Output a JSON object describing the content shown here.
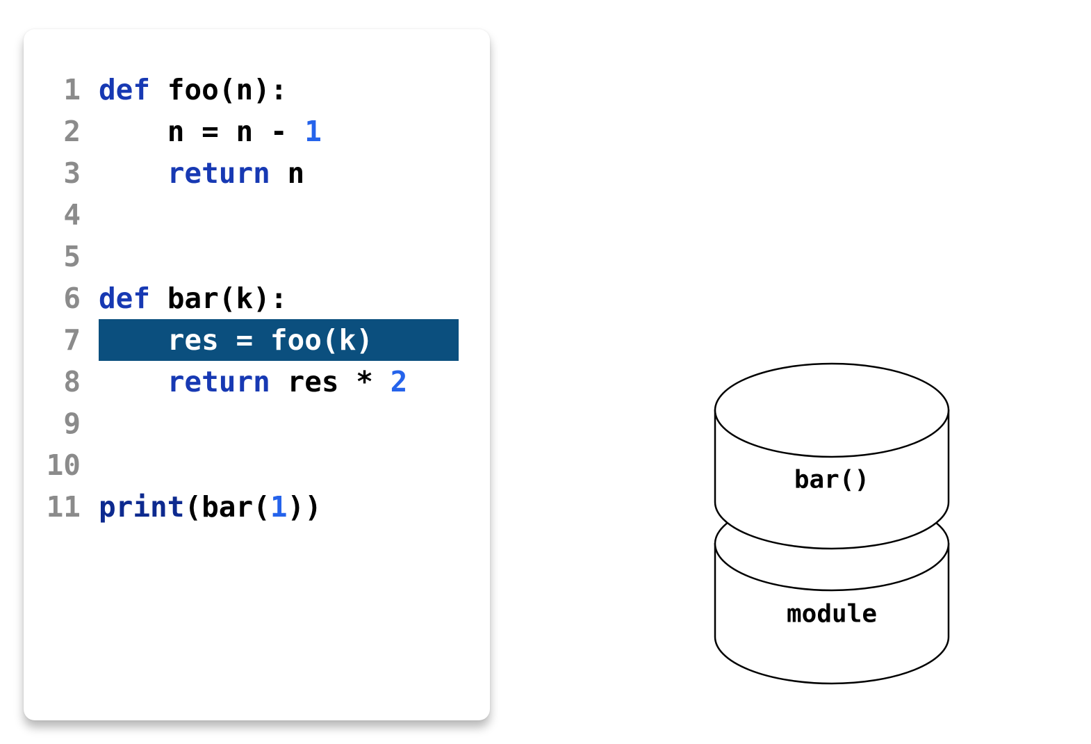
{
  "code": {
    "lines": [
      {
        "number": "1",
        "tokens": [
          {
            "t": "kw",
            "v": "def"
          },
          {
            "t": "plain",
            "v": " foo(n):"
          }
        ]
      },
      {
        "number": "2",
        "tokens": [
          {
            "t": "plain",
            "v": "    n = n - "
          },
          {
            "t": "num",
            "v": "1"
          }
        ]
      },
      {
        "number": "3",
        "tokens": [
          {
            "t": "plain",
            "v": "    "
          },
          {
            "t": "kw",
            "v": "return"
          },
          {
            "t": "plain",
            "v": " n"
          }
        ]
      },
      {
        "number": "4",
        "tokens": []
      },
      {
        "number": "5",
        "tokens": []
      },
      {
        "number": "6",
        "tokens": [
          {
            "t": "kw",
            "v": "def"
          },
          {
            "t": "plain",
            "v": " bar(k):"
          }
        ]
      },
      {
        "number": "7",
        "tokens": [
          {
            "t": "plain",
            "v": "    res = foo(k)"
          }
        ]
      },
      {
        "number": "8",
        "tokens": [
          {
            "t": "plain",
            "v": "    "
          },
          {
            "t": "kw",
            "v": "return"
          },
          {
            "t": "plain",
            "v": " res * "
          },
          {
            "t": "num",
            "v": "2"
          }
        ]
      },
      {
        "number": "9",
        "tokens": []
      },
      {
        "number": "10",
        "tokens": []
      },
      {
        "number": "11",
        "tokens": [
          {
            "t": "bi",
            "v": "print"
          },
          {
            "t": "plain",
            "v": "(bar("
          },
          {
            "t": "num",
            "v": "1"
          },
          {
            "t": "plain",
            "v": "))"
          }
        ]
      }
    ],
    "highlighted_line": 7
  },
  "stack": {
    "frames": [
      {
        "label": "bar()"
      },
      {
        "label": "module"
      }
    ]
  },
  "colors": {
    "keyword": "#1739b3",
    "number": "#2563eb",
    "builtin": "#0d2a8f",
    "line_number": "#8b8b8b",
    "highlight": "#0b4f7e"
  }
}
